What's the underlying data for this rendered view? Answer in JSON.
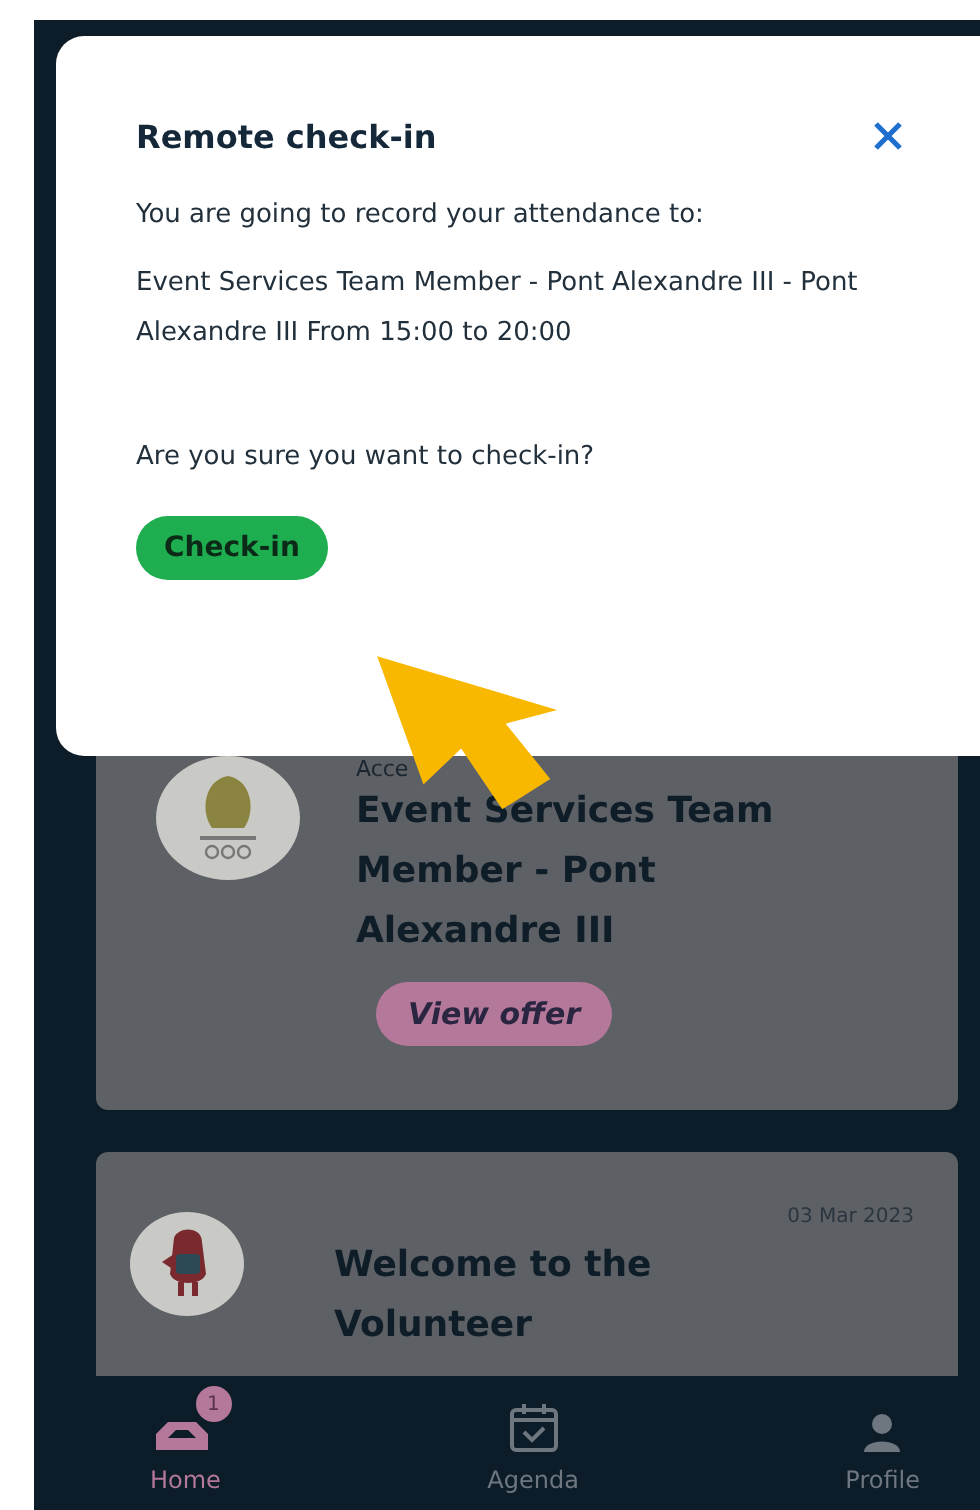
{
  "modal": {
    "title": "Remote check-in",
    "intro": "You are going to record your attendance to:",
    "event": "Event Services Team Member - Pont Alexandre III - Pont Alexandre III From 15:00 to 20:00",
    "question": "Are you sure you want to check-in?",
    "confirm_button": "Check-in"
  },
  "cards": [
    {
      "label": "Acce",
      "title": "Event Services Team Member - Pont Alexandre III",
      "button": "View offer"
    },
    {
      "date": "03 Mar 2023",
      "title": "Welcome to the Volunteer"
    }
  ],
  "nav": [
    {
      "label": "Home",
      "selected": true,
      "badge": "1"
    },
    {
      "label": "Agenda",
      "selected": false
    },
    {
      "label": "Profile",
      "selected": false
    }
  ]
}
